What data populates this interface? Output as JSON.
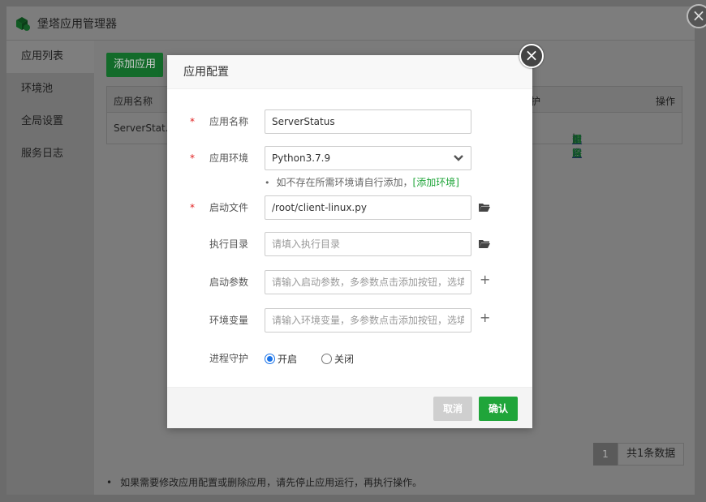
{
  "outer": {
    "title": "堡塔应用管理器",
    "sidebar": [
      {
        "label": "应用列表",
        "active": true
      },
      {
        "label": "环境池",
        "active": false
      },
      {
        "label": "全局设置",
        "active": false
      },
      {
        "label": "服务日志",
        "active": false
      }
    ],
    "add_button": "添加应用",
    "table": {
      "col_name": "应用名称",
      "col_guard": "护",
      "col_ops": "操作",
      "row_name": "ServerStat...",
      "ops": {
        "restart": "重启",
        "config": "配置",
        "log": "日志",
        "delete": "删除"
      }
    },
    "pager": {
      "page": "1",
      "total": "共1条数据"
    },
    "note": "如果需要修改应用配置或删除应用，请先停止应用运行，再执行操作。"
  },
  "modal": {
    "title": "应用配置",
    "fields": {
      "app_name": {
        "label": "应用名称",
        "value": "ServerStatus"
      },
      "env": {
        "label": "应用环境",
        "value": "Python3.7.9"
      },
      "hint": {
        "text": "如不存在所需环境请自行添加，",
        "link": "[添加环境]"
      },
      "start_file": {
        "label": "启动文件",
        "value": "/root/client-linux.py"
      },
      "work_dir": {
        "label": "执行目录",
        "placeholder": "请填入执行目录"
      },
      "start_args": {
        "label": "启动参数",
        "placeholder": "请输入启动参数，多参数点击添加按钮，选填"
      },
      "env_vars": {
        "label": "环境变量",
        "placeholder": "请输入环境变量，多参数点击添加按钮，选填"
      },
      "daemon": {
        "label": "进程守护",
        "on": "开启",
        "off": "关闭"
      }
    },
    "buttons": {
      "cancel": "取消",
      "ok": "确认"
    }
  },
  "required_mark": "*",
  "colors": {
    "accent_green": "#20a53a",
    "required_red": "#e02020",
    "radio_blue": "#1a73e8"
  }
}
